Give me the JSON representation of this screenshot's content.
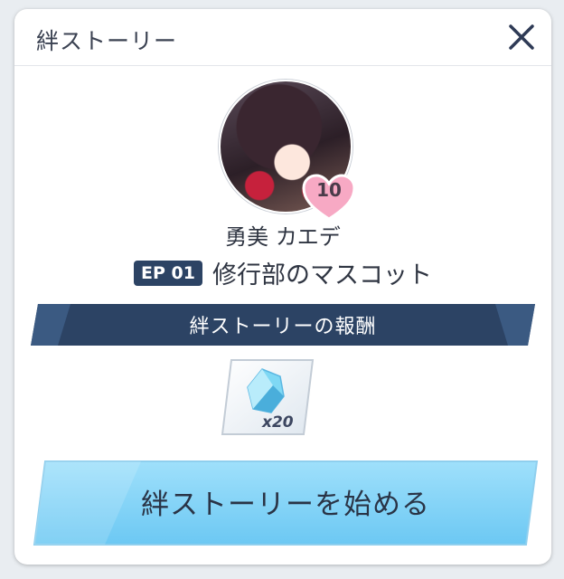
{
  "dialog": {
    "title": "絆ストーリー",
    "close_icon": "close-icon"
  },
  "character": {
    "name": "勇美 カエデ",
    "bond_level": "10",
    "avatar": "character-portrait"
  },
  "episode": {
    "badge": "EP 01",
    "title": "修行部のマスコット"
  },
  "reward": {
    "header": "絆ストーリーの報酬",
    "item_icon": "blue-gem-icon",
    "quantity": "x20"
  },
  "actions": {
    "start_label": "絆ストーリーを始める"
  },
  "colors": {
    "navy": "#2c4364",
    "button_blue": "#7dd2f7",
    "heart_pink": "#f7a9c4"
  }
}
